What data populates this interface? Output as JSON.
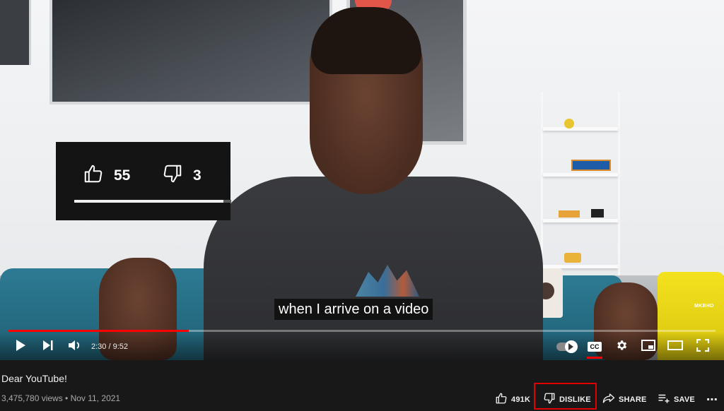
{
  "overlay": {
    "like_count": "55",
    "dislike_count": "3",
    "ratio": 0.95
  },
  "video": {
    "caption": "when I arrive on a video",
    "channel_watermark": "MKBHD",
    "time_display": "2:30 / 9:52",
    "progress_fraction": 0.255
  },
  "controls": {
    "icons": [
      "play-icon",
      "next-icon",
      "volume-icon",
      "autoplay-toggle",
      "cc-icon",
      "settings-icon",
      "miniplayer-icon",
      "theater-icon",
      "fullscreen-icon"
    ],
    "cc_label": "CC"
  },
  "info": {
    "title": "Dear YouTube!",
    "meta": "3,475,780 views • Nov 11, 2021",
    "actions": {
      "like_label": "491K",
      "dislike_label": "DISLIKE",
      "share_label": "SHARE",
      "save_label": "SAVE",
      "more_label": "⋯"
    }
  },
  "colors": {
    "accent_red": "#ff0000",
    "highlight_box": "#e00000",
    "background": "#181818"
  }
}
